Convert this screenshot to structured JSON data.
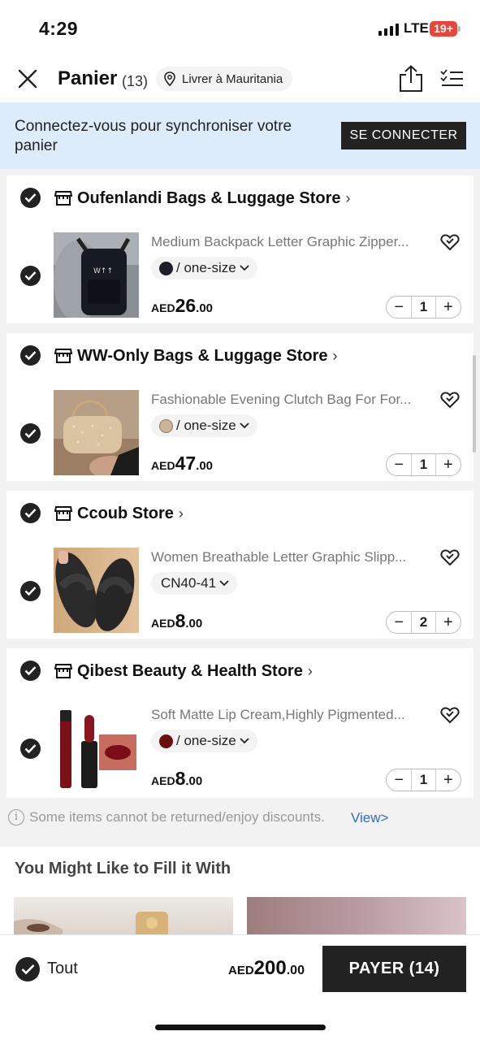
{
  "status_bar": {
    "time": "4:29",
    "network": "LTE",
    "battery": "19+"
  },
  "header": {
    "title": "Panier",
    "count": "(13)",
    "ship_to": "Livrer à Mauritania",
    "icons": [
      "close-icon",
      "location-pin-icon",
      "share-icon",
      "checklist-icon"
    ]
  },
  "banner": {
    "message": "Connectez-vous pour synchroniser votre panier",
    "button": "SE CONNECTER"
  },
  "stores": [
    {
      "name": "Oufenlandi Bags & Luggage Store",
      "selected": true,
      "product": {
        "title": "Medium Backpack Letter Graphic Zipper...",
        "variant": "/ one-size",
        "swatch_color": "#1c1f2a",
        "currency": "AED",
        "price_int": "26",
        "price_dec": ".00",
        "quantity": "1",
        "selected": true
      }
    },
    {
      "name": "WW-Only Bags & Luggage Store",
      "selected": true,
      "product": {
        "title": "Fashionable Evening Clutch Bag For For...",
        "variant": "/ one-size",
        "swatch_color": "#c9b59a",
        "currency": "AED",
        "price_int": "47",
        "price_dec": ".00",
        "quantity": "1",
        "selected": true
      }
    },
    {
      "name": "Ccoub Store",
      "selected": true,
      "product": {
        "title": "Women Breathable Letter Graphic Slipp...",
        "variant": "CN40-41",
        "swatch_color": "",
        "currency": "AED",
        "price_int": "8",
        "price_dec": ".00",
        "quantity": "2",
        "selected": true
      }
    },
    {
      "name": "Qibest Beauty & Health Store",
      "selected": true,
      "product": {
        "title": "Soft Matte Lip Cream,Highly Pigmented...",
        "variant": "/ one-size",
        "swatch_color": "#6b0f0f",
        "currency": "AED",
        "price_int": "8",
        "price_dec": ".00",
        "quantity": "1",
        "selected": true
      }
    }
  ],
  "qty_controls": {
    "minus": "−",
    "plus": "+"
  },
  "notice": {
    "text": "Some items cannot be returned/enjoy discounts.",
    "link": "View>"
  },
  "recommendations": {
    "title": "You Might Like to Fill it With"
  },
  "footer": {
    "select_all_label": "Tout",
    "currency": "AED",
    "total_int": "200",
    "total_dec": ".00",
    "pay_button": "PAYER (14)"
  }
}
